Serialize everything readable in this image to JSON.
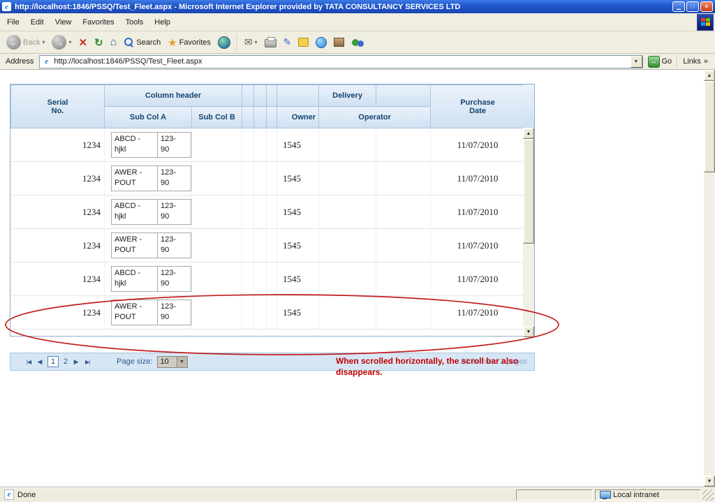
{
  "window": {
    "title": "http://localhost:1846/PSSQ/Test_Fleet.aspx - Microsoft Internet Explorer provided by TATA CONSULTANCY SERVICES LTD"
  },
  "menu": {
    "items": [
      "File",
      "Edit",
      "View",
      "Favorites",
      "Tools",
      "Help"
    ]
  },
  "toolbar": {
    "back": "Back",
    "search": "Search",
    "favorites": "Favorites"
  },
  "address": {
    "label": "Address",
    "url": "http://localhost:1846/PSSQ/Test_Fleet.aspx",
    "go": "Go",
    "links": "Links"
  },
  "grid": {
    "header": {
      "serial": "Serial\nNo.",
      "column_header": "Column header",
      "sub_col_a": "Sub Col A",
      "sub_col_b": "Sub Col B",
      "owner": "Owner",
      "delivery": "Delivery",
      "operator": "Operator",
      "purchase": "Purchase\nDate"
    },
    "rows": [
      {
        "serial": "1234",
        "a1": "ABCD -\nhjkl",
        "a2": "123-\n90",
        "owner": "1545",
        "date": "11/07/2010"
      },
      {
        "serial": "1234",
        "a1": "AWER -\nPOUT",
        "a2": "123-\n90",
        "owner": "1545",
        "date": "11/07/2010"
      },
      {
        "serial": "1234",
        "a1": "ABCD -\nhjkl",
        "a2": "123-\n90",
        "owner": "1545",
        "date": "11/07/2010"
      },
      {
        "serial": "1234",
        "a1": "AWER -\nPOUT",
        "a2": "123-\n90",
        "owner": "1545",
        "date": "11/07/2010"
      },
      {
        "serial": "1234",
        "a1": "ABCD -\nhjkl",
        "a2": "123-\n90",
        "owner": "1545",
        "date": "11/07/2010"
      },
      {
        "serial": "1234",
        "a1": "AWER -\nPOUT",
        "a2": "123-\n90",
        "owner": "1545",
        "date": "11/07/2010"
      }
    ]
  },
  "pager": {
    "page1": "1",
    "page2": "2",
    "page_size_label": "Page size:",
    "page_size_value": "10",
    "items_text": "20 items in 2 pages"
  },
  "annotation": {
    "text": "When scrolled horizontally, the scroll bar also disappears."
  },
  "status": {
    "left": "Done",
    "right": "Local intranet"
  },
  "icons": {
    "ie_logo": "e",
    "back_arrow": "←",
    "forward_arrow": "→",
    "dropdown_caret": "▾",
    "stop": "✕",
    "refresh": "↻",
    "home": "⌂",
    "favorites_star": "★",
    "mail": "✉",
    "edit": "✎",
    "go_arrow": "→",
    "links_chevrons": "»",
    "minimize": "▁",
    "maximize": "□",
    "close": "✕",
    "scroll_up": "▲",
    "scroll_down": "▼",
    "pager_first": "|◀",
    "pager_prev": "◀",
    "pager_next": "▶",
    "pager_last": "▶|",
    "dropdown_arrow": "▼"
  },
  "colors": {
    "annotation_red": "#c00000",
    "grid_header_text": "#17456e",
    "titlebar_blue": "#2258ce",
    "pager_background": "#d7e6f4"
  }
}
